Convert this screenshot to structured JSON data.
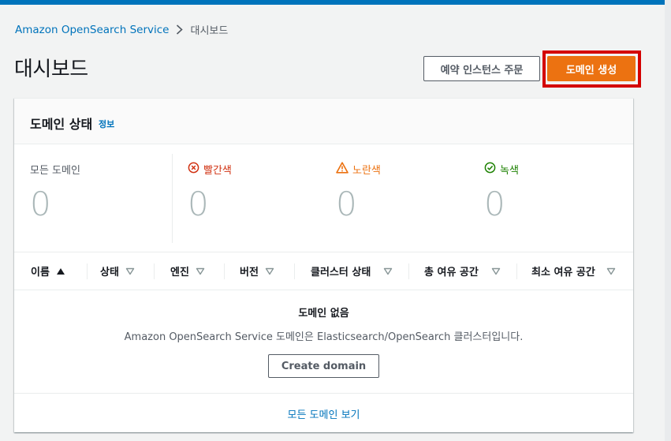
{
  "breadcrumb": {
    "root": "Amazon OpenSearch Service",
    "current": "대시보드"
  },
  "header": {
    "title": "대시보드",
    "reserved_label": "예약 인스턴스 주문",
    "create_label": "도메인 생성"
  },
  "status_panel": {
    "title": "도메인 상태",
    "info": "정보",
    "stats": [
      {
        "label": "모든 도메인",
        "value": "0",
        "icon": "none",
        "color": "#545b64"
      },
      {
        "label": "빨간색",
        "value": "0",
        "icon": "error-circle-icon",
        "color": "#d13212"
      },
      {
        "label": "노란색",
        "value": "0",
        "icon": "warning-triangle-icon",
        "color": "#ec7211"
      },
      {
        "label": "녹색",
        "value": "0",
        "icon": "check-circle-icon",
        "color": "#1d8102"
      }
    ]
  },
  "table": {
    "columns": [
      "이름",
      "상태",
      "엔진",
      "버전",
      "클러스터 상태",
      "총 여유 공간",
      "최소 여유 공간"
    ],
    "empty_title": "도메인 없음",
    "empty_desc": "Amazon OpenSearch Service 도메인은 Elasticsearch/OpenSearch 클러스터입니다.",
    "create_domain_label": "Create domain"
  },
  "footer": {
    "link": "모든 도메인 보기"
  },
  "colors": {
    "accent": "#0073bb",
    "primary_button": "#ec7211",
    "highlight": "#d40000"
  }
}
